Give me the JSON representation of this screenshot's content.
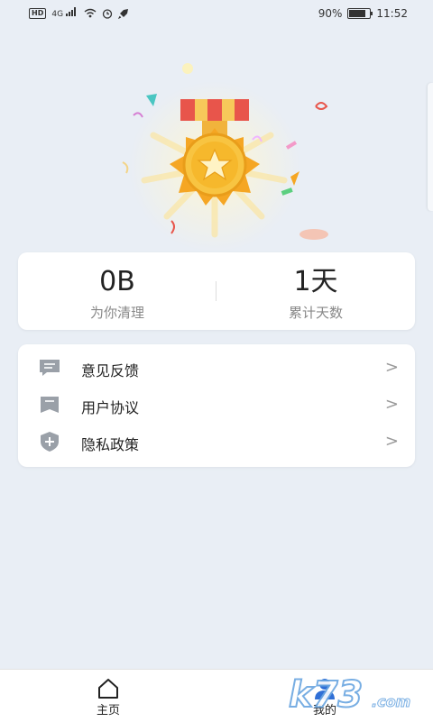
{
  "status_bar": {
    "left_badge": "HD",
    "network": "4G",
    "battery_text": "90%",
    "battery_level": 0.9,
    "time": "11:52",
    "icons": [
      "hd-icon",
      "signal-icon",
      "wifi-icon",
      "alarm-icon",
      "rocket-icon",
      "battery-icon"
    ]
  },
  "stats": {
    "cleaned": {
      "value": "0B",
      "label": "为你清理"
    },
    "days": {
      "value": "1天",
      "label": "累计天数"
    }
  },
  "menu": {
    "items": [
      {
        "label": "意见反馈",
        "icon": "feedback-icon"
      },
      {
        "label": "用户协议",
        "icon": "agreement-icon"
      },
      {
        "label": "隐私政策",
        "icon": "privacy-shield-icon"
      }
    ],
    "chevron": ">"
  },
  "tabbar": {
    "tabs": [
      {
        "label": "主页",
        "icon": "home-icon"
      },
      {
        "label": "我的",
        "icon": "profile-icon"
      }
    ]
  },
  "watermark": {
    "text": "k73.com"
  },
  "colors": {
    "background": "#e9eef5",
    "card": "#ffffff",
    "medal_gold": "#f6b82c",
    "ribbon_red": "#e8554b",
    "icon_gray": "#9aa0a8"
  }
}
